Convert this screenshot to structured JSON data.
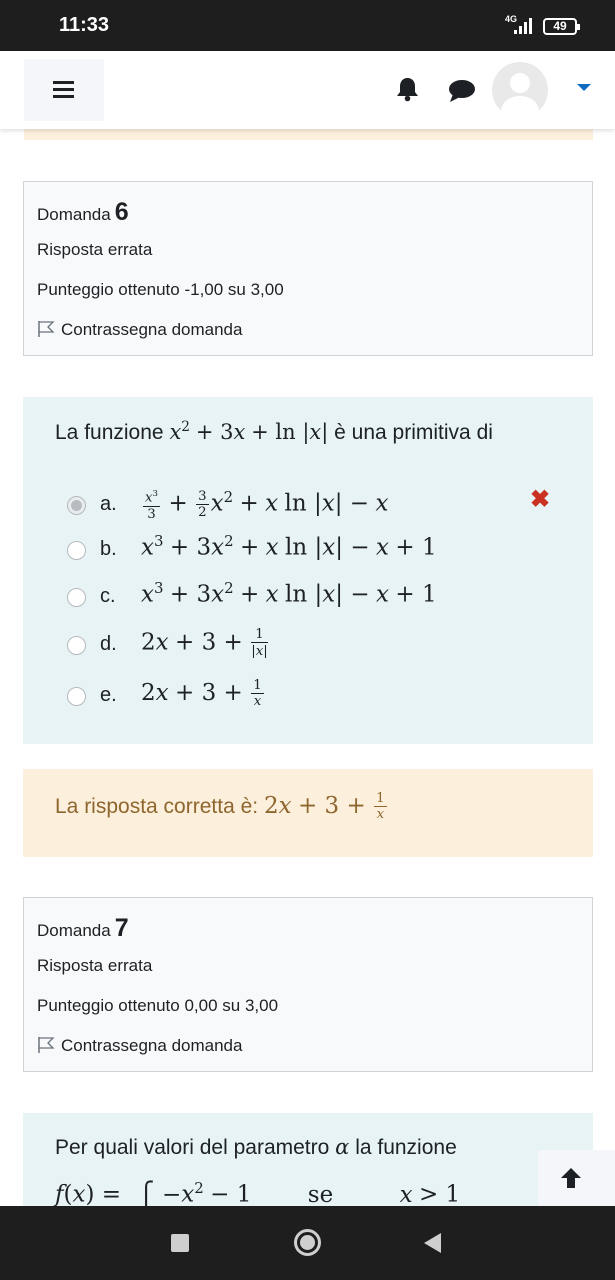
{
  "statusbar": {
    "time": "11:33",
    "network": "4G",
    "battery": "49"
  },
  "navbar": {
    "menu_icon": "hamburger-icon",
    "notification_icon": "bell-icon",
    "messages_icon": "chat-icon",
    "user_icon": "avatar",
    "accent": "#0f6cbf"
  },
  "question6": {
    "label": "Domanda",
    "number": "6",
    "state": "Risposta errata",
    "grade": "Punteggio ottenuto -1,00 su 3,00",
    "flag": "Contrassegna domanda",
    "text_before": "La funzione",
    "text_after": "è una primitiva di",
    "answers": [
      {
        "letter": "a.",
        "selected": true,
        "result": "wrong"
      },
      {
        "letter": "b.",
        "selected": false
      },
      {
        "letter": "c.",
        "selected": false
      },
      {
        "letter": "d.",
        "selected": false
      },
      {
        "letter": "e.",
        "selected": false
      }
    ],
    "feedback": "La risposta corretta è:"
  },
  "question7": {
    "label": "Domanda",
    "number": "7",
    "state": "Risposta errata",
    "grade": "Punteggio ottenuto 0,00 su 3,00",
    "flag": "Contrassegna domanda",
    "text_before": "Per quali valori del parametro",
    "text_after": "la funzione",
    "se": "se"
  },
  "colors": {
    "formulation_bg": "#e7f3f5",
    "feedback_bg": "#fcefdc",
    "feedback_text": "#8e662e",
    "wrong": "#ca3120"
  }
}
